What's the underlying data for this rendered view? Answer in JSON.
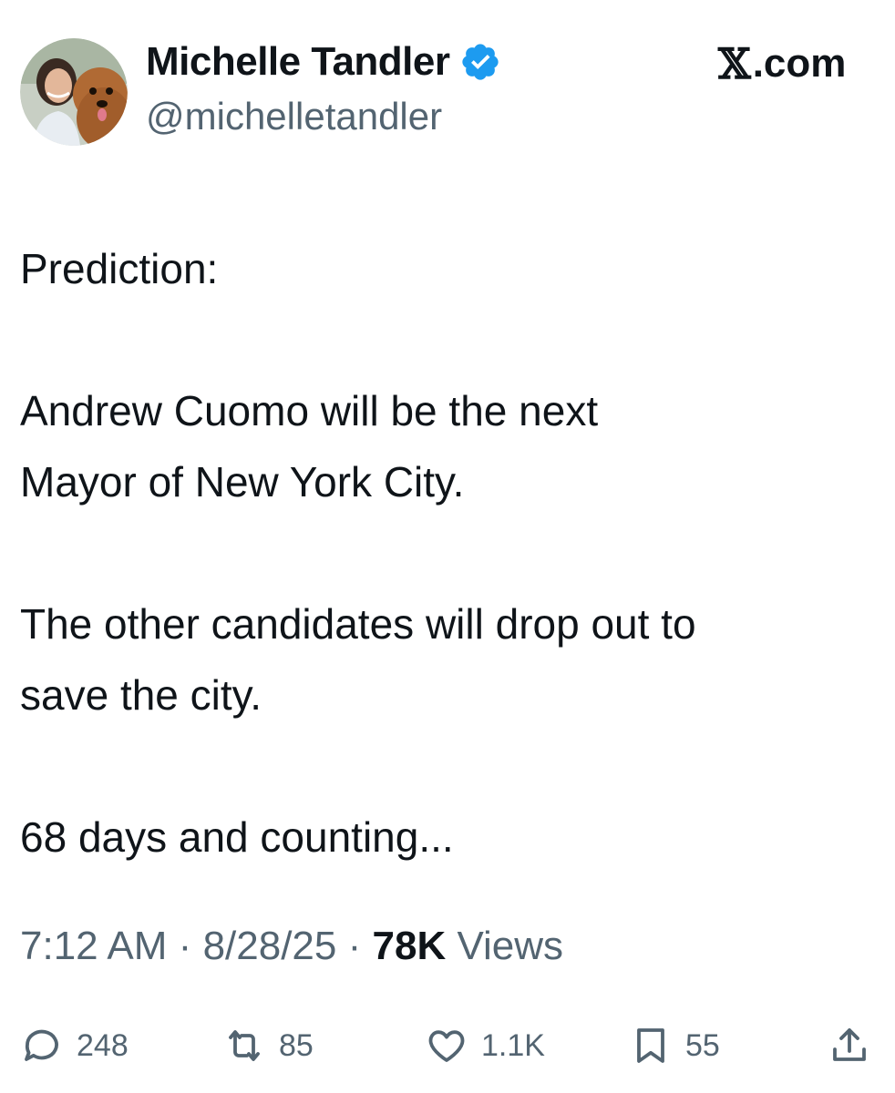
{
  "header": {
    "display_name": "Michelle Tandler",
    "handle": "@michelletandler",
    "site_label_x": "𝕏",
    "site_label_rest": ".com",
    "verified_badge_icon": "verified-badge-icon",
    "badge_color": "#1d9bf0"
  },
  "tweet": {
    "paragraphs": [
      [
        "Prediction:"
      ],
      [
        "Andrew Cuomo will be the next",
        "Mayor of New York City."
      ],
      [
        "The other candidates will drop out to",
        "save the city."
      ],
      [
        "68 days and counting..."
      ]
    ]
  },
  "meta": {
    "time": "7:12 AM",
    "separator": "·",
    "date": "8/28/25",
    "views_count": "78K",
    "views_label": "Views"
  },
  "actions": {
    "reply": {
      "icon": "reply-icon",
      "count": "248"
    },
    "repost": {
      "icon": "repost-icon",
      "count": "85"
    },
    "like": {
      "icon": "heart-icon",
      "count": "1.1K"
    },
    "bookmark": {
      "icon": "bookmark-icon",
      "count": "55"
    },
    "share": {
      "icon": "share-icon"
    }
  },
  "colors": {
    "text_primary": "#0f1419",
    "text_secondary": "#536471"
  }
}
